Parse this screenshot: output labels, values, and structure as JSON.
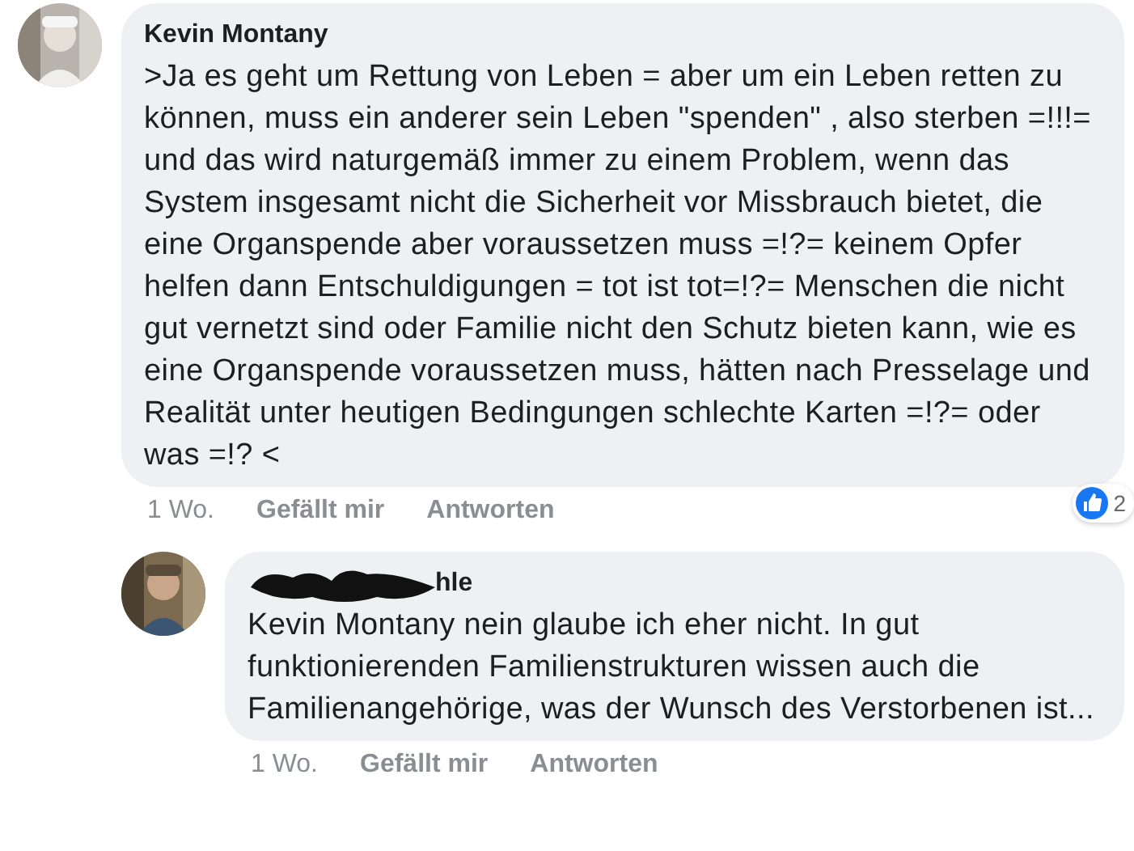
{
  "comments": [
    {
      "author": "Kevin Montany",
      "author_redacted": false,
      "text": ">Ja es geht um Rettung von Leben = aber um ein Leben retten zu können, muss ein anderer sein Leben \"spenden\" , also sterben =!!!= und das wird naturgemäß immer zu einem Problem, wenn das System insgesamt nicht die Sicherheit vor Missbrauch bietet, die eine Organspende aber voraussetzen muss =!?= keinem Opfer helfen dann Entschuldigungen = tot ist tot=!?= Menschen die nicht gut vernetzt sind oder Familie nicht den Schutz bieten kann, wie es eine Organspende voraussetzen muss, hätten nach Presselage und Realität unter heutigen Bedingungen schlechte Karten =!?= oder was =!? <",
      "time": "1 Wo.",
      "actions": [
        "Gefällt mir",
        "Antworten"
      ],
      "reactions": "2",
      "reply": false
    },
    {
      "author": "hle",
      "author_redacted": true,
      "text": "Kevin Montany nein glaube ich eher nicht. In gut funktionierenden Familienstrukturen wissen auch die Familienangehörige, was der Wunsch des Verstorbenen ist...",
      "time": "1 Wo.",
      "actions": [
        "Gefällt mir",
        "Antworten"
      ],
      "reply": true
    }
  ]
}
